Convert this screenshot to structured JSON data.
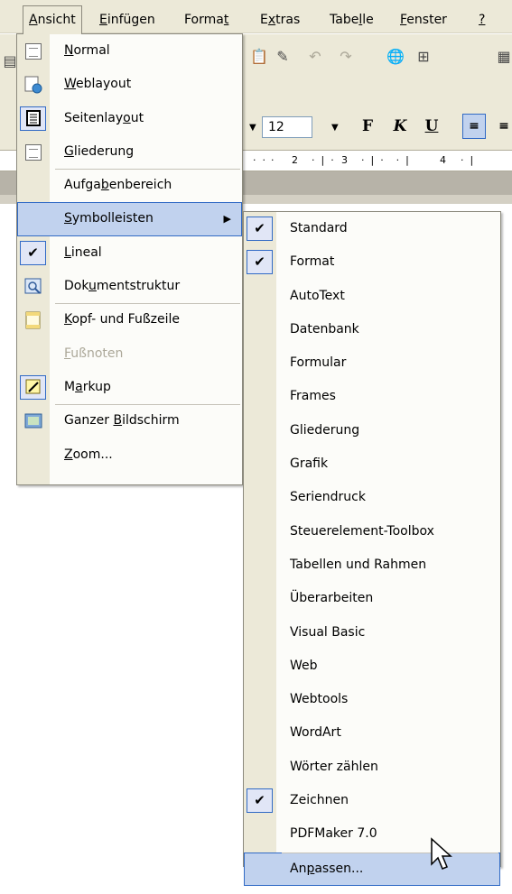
{
  "menubar": {
    "items": [
      {
        "label": "Ansicht",
        "underline": "A",
        "rest": "nsicht"
      },
      {
        "label": "Einfügen",
        "underline": "E",
        "rest": "infügen"
      },
      {
        "label": "Format",
        "pre": "Forma",
        "underline": "t",
        "rest": ""
      },
      {
        "label": "Extras",
        "pre": "E",
        "underline": "x",
        "rest": "tras"
      },
      {
        "label": "Tabelle",
        "pre": "Tabe",
        "underline": "l",
        "rest": "le"
      },
      {
        "label": "Fenster",
        "underline": "F",
        "rest": "enster"
      },
      {
        "label": "?",
        "underline": "?",
        "rest": ""
      }
    ]
  },
  "toolbar": {
    "font_size": "12",
    "bold_label": "F",
    "italic_label": "K",
    "underline_label": "U"
  },
  "ruler": {
    "marks": [
      "2",
      "3",
      "4"
    ]
  },
  "ansicht_menu": {
    "items": [
      {
        "pre": "",
        "u": "N",
        "post": "ormal",
        "icon": "normal-view-icon"
      },
      {
        "pre": "",
        "u": "W",
        "post": "eblayout",
        "icon": "web-layout-icon"
      },
      {
        "pre": "Seitenlay",
        "u": "o",
        "post": "ut",
        "icon": "print-layout-icon"
      },
      {
        "pre": "",
        "u": "G",
        "post": "liederung",
        "icon": "outline-view-icon"
      },
      {
        "pre": "Aufga",
        "u": "b",
        "post": "enbereich",
        "icon": ""
      },
      {
        "pre": "",
        "u": "S",
        "post": "ymbolleisten",
        "icon": ""
      },
      {
        "pre": "",
        "u": "L",
        "post": "ineal",
        "icon": "checkmark-icon"
      },
      {
        "pre": "Dok",
        "u": "u",
        "post": "mentstruktur",
        "icon": "document-map-icon"
      },
      {
        "pre": "",
        "u": "K",
        "post": "opf- und Fußzeile",
        "icon": "header-footer-icon"
      },
      {
        "pre": "",
        "u": "F",
        "post": "ußnoten",
        "icon": ""
      },
      {
        "pre": "M",
        "u": "a",
        "post": "rkup",
        "icon": "markup-icon"
      },
      {
        "pre": "Ganzer ",
        "u": "B",
        "post": "ildschirm",
        "icon": "full-screen-icon"
      },
      {
        "pre": "",
        "u": "Z",
        "post": "oom...",
        "icon": ""
      }
    ]
  },
  "symbolleisten_menu": {
    "items": [
      {
        "label": "Standard",
        "checked": true
      },
      {
        "label": "Format",
        "checked": true
      },
      {
        "label": "AutoText",
        "checked": false
      },
      {
        "label": "Datenbank",
        "checked": false
      },
      {
        "label": "Formular",
        "checked": false
      },
      {
        "label": "Frames",
        "checked": false
      },
      {
        "label": "Gliederung",
        "checked": false
      },
      {
        "label": "Grafik",
        "checked": false
      },
      {
        "label": "Seriendruck",
        "checked": false
      },
      {
        "label": "Steuerelement-Toolbox",
        "checked": false
      },
      {
        "label": "Tabellen und Rahmen",
        "checked": false
      },
      {
        "label": "Überarbeiten",
        "checked": false
      },
      {
        "label": "Visual Basic",
        "checked": false
      },
      {
        "label": "Web",
        "checked": false
      },
      {
        "label": "Webtools",
        "checked": false
      },
      {
        "label": "WordArt",
        "checked": false
      },
      {
        "label": "Wörter zählen",
        "checked": false
      },
      {
        "label": "Zeichnen",
        "checked": true
      },
      {
        "label": "PDFMaker 7.0",
        "checked": false
      }
    ],
    "anpassen": {
      "pre": "An",
      "u": "p",
      "post": "assen..."
    }
  },
  "colors": {
    "menu_bg": "#fcfcf9",
    "gutter": "#ece9d8",
    "highlight": "#c1d2ee",
    "highlight_border": "#316ac5",
    "disabled_text": "#aca899"
  }
}
